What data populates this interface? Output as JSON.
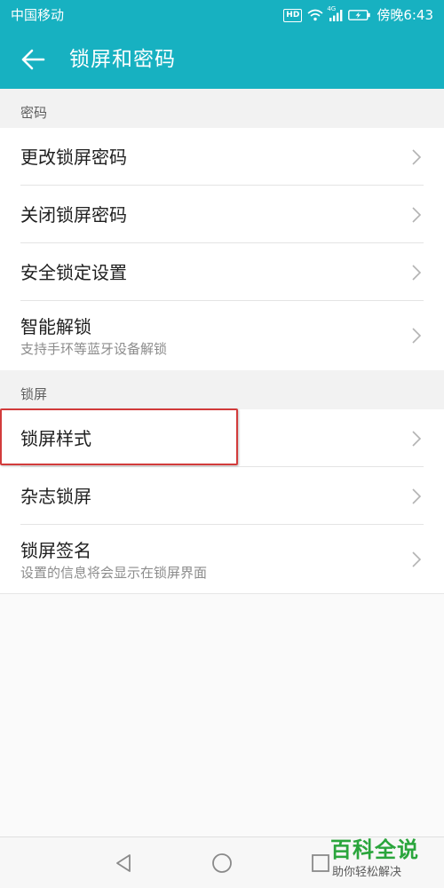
{
  "status_bar": {
    "carrier": "中国移动",
    "hd_label": "HD",
    "network_label": "4G",
    "time": "傍晚6:43"
  },
  "appbar": {
    "title": "锁屏和密码",
    "back_icon": "arrow-left-icon"
  },
  "sections": {
    "password": {
      "header": "密码",
      "items": [
        {
          "title": "更改锁屏密码"
        },
        {
          "title": "关闭锁屏密码"
        },
        {
          "title": "安全锁定设置"
        },
        {
          "title": "智能解锁",
          "subtitle": "支持手环等蓝牙设备解锁"
        }
      ]
    },
    "lockscreen": {
      "header": "锁屏",
      "items": [
        {
          "title": "锁屏样式"
        },
        {
          "title": "杂志锁屏"
        },
        {
          "title": "锁屏签名",
          "subtitle": "设置的信息将会显示在锁屏界面"
        }
      ]
    }
  },
  "navbar": {
    "icons": [
      "triangle-back-icon",
      "circle-home-icon",
      "square-recent-icon"
    ]
  },
  "watermark": {
    "title": "百科全说",
    "subtitle": "助你轻松解决"
  },
  "colors": {
    "accent": "#17b1c1",
    "highlight": "#d23b3b",
    "watermark": "#2aa53c"
  }
}
